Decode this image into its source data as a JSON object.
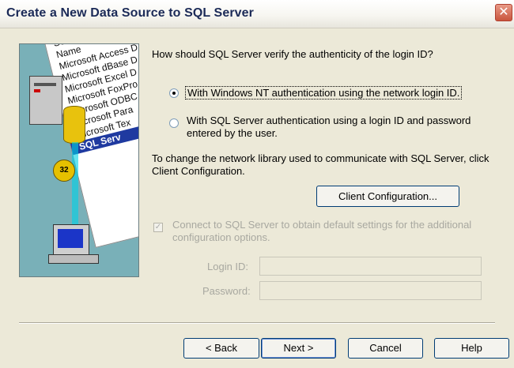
{
  "window": {
    "title": "Create a New Data Source to SQL Server",
    "close_glyph": "✕"
  },
  "art": {
    "list_header": "Select a driver for",
    "drivers": [
      "Name",
      "Microsoft Access D",
      "Microsoft dBase D",
      "Microsoft Excel D",
      "Microsoft FoxPro",
      "Microsoft ODBC",
      "Microsoft Para",
      "Microsoft Tex",
      "SQL Serv"
    ],
    "disk_label": "32"
  },
  "form": {
    "question": "How should SQL Server verify the authenticity of the login ID?",
    "option_nt": "With Windows NT authentication using the network login ID.",
    "option_sql": "With SQL Server authentication using a login ID and password entered by the user.",
    "network_info": "To change the network library used to communicate with SQL Server, click Client Configuration.",
    "client_config_button": "Client Configuration...",
    "connect_checkbox_label": "Connect to SQL Server to obtain default settings for the additional configuration options.",
    "login_id_label": "Login ID:",
    "login_id_value": "",
    "password_label": "Password:",
    "password_value": ""
  },
  "buttons": {
    "back": "< Back",
    "next": "Next >",
    "cancel": "Cancel",
    "help": "Help"
  },
  "colors": {
    "dialog_bg": "#ece9d8",
    "title_text": "#1b2a57",
    "disabled_text": "#a8a8a0",
    "button_border": "#003c74"
  }
}
